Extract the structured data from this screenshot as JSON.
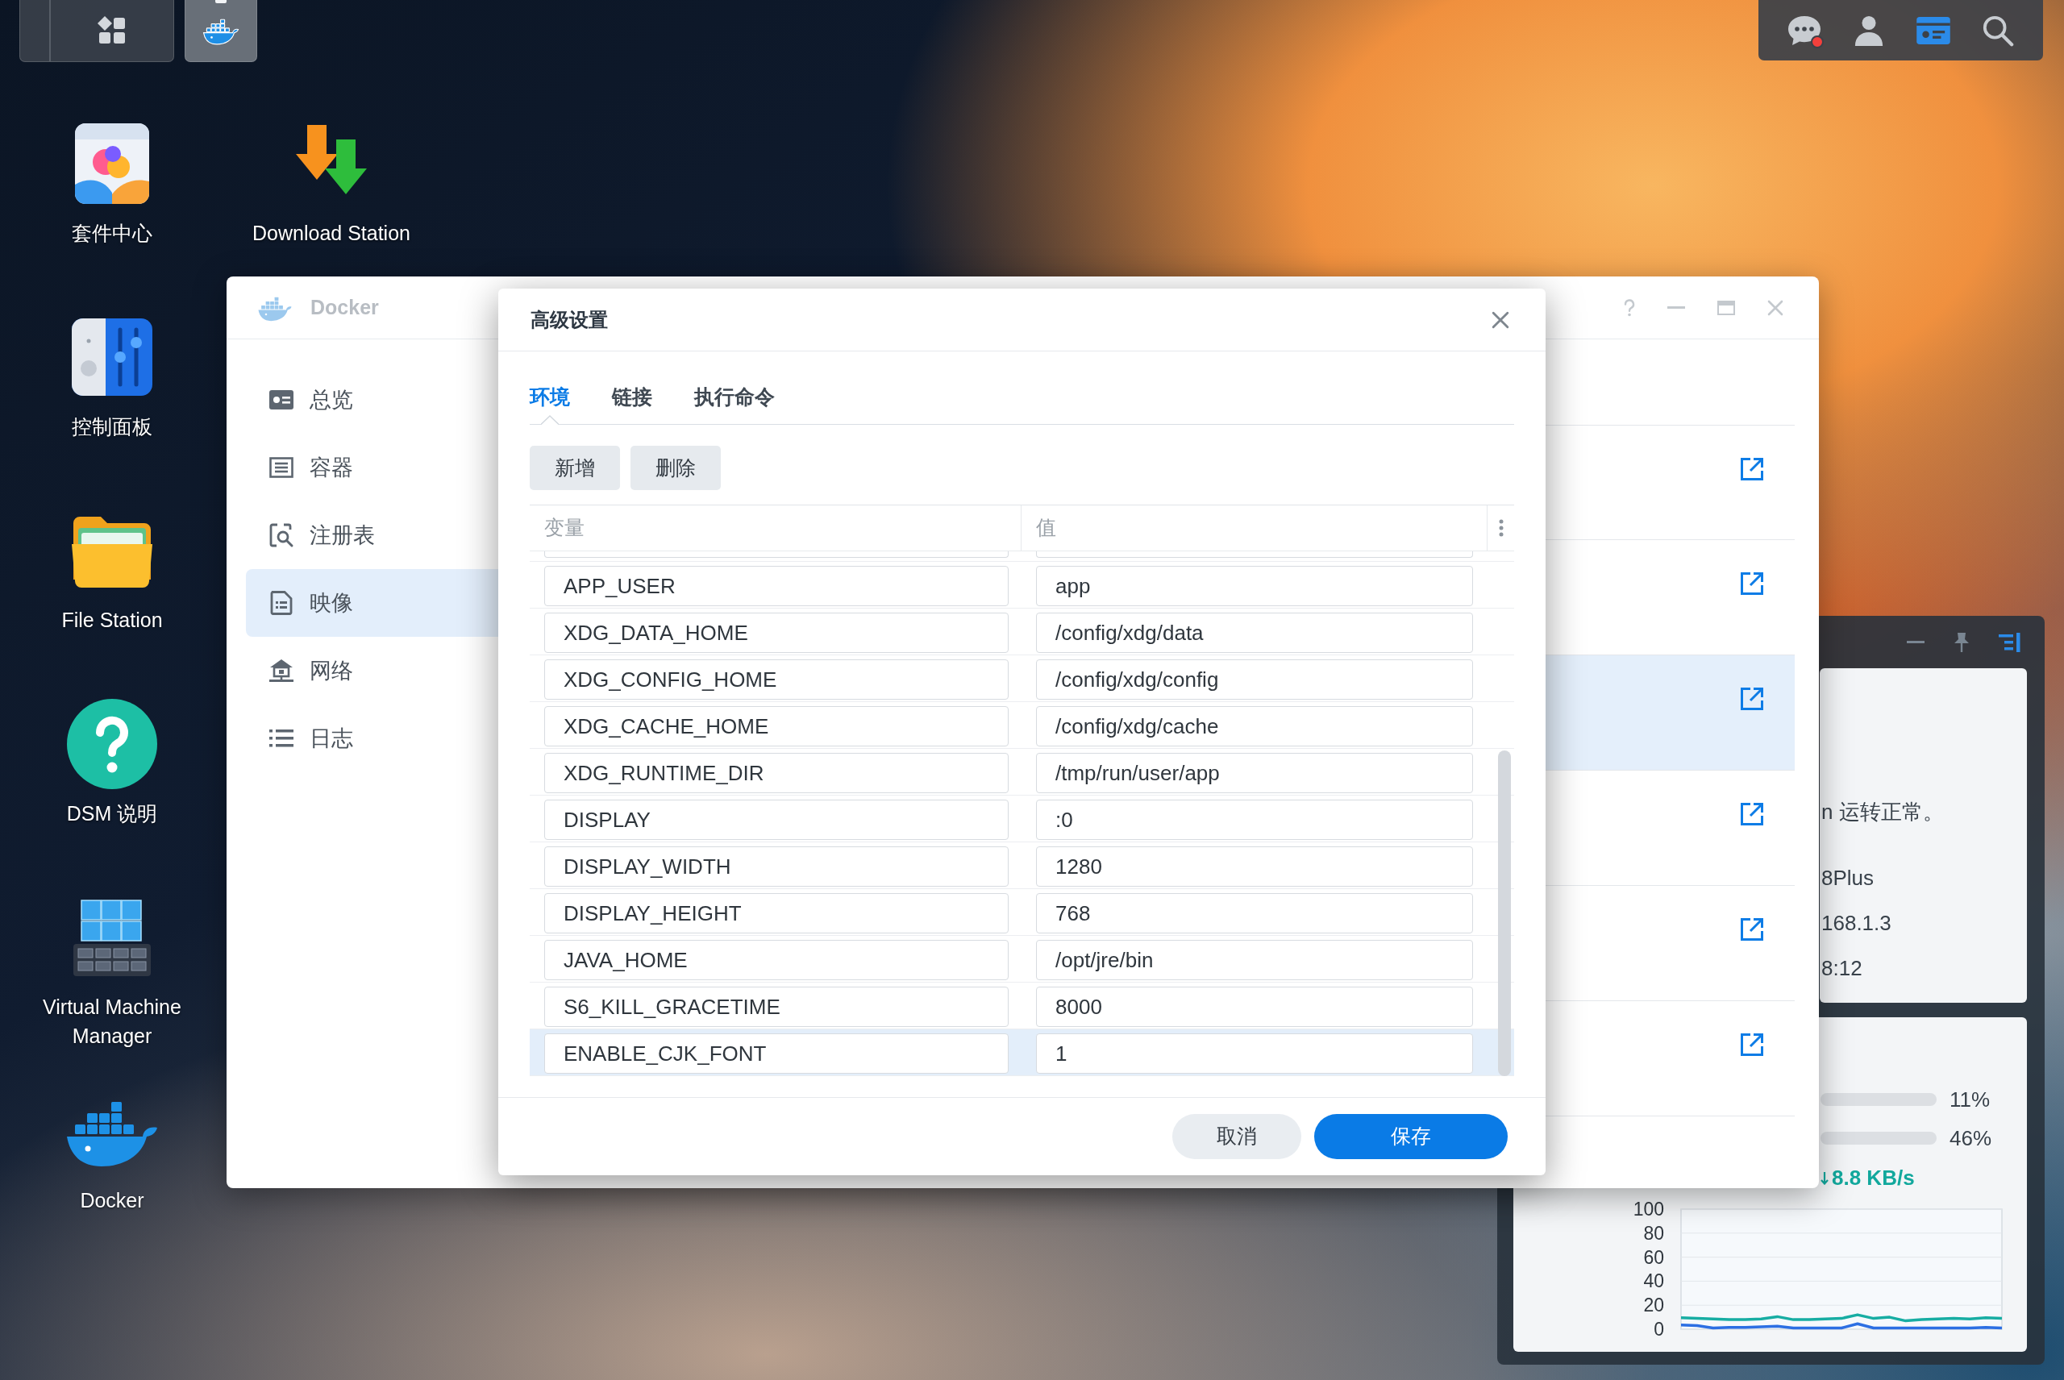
{
  "taskbar": {
    "items": [
      {
        "kind": "main-menu",
        "active": false
      },
      {
        "kind": "docker",
        "active": true
      }
    ]
  },
  "tray": {
    "items": [
      {
        "kind": "notifications",
        "on": false,
        "alert": true
      },
      {
        "kind": "user",
        "on": false,
        "alert": false
      },
      {
        "kind": "widgets",
        "on": true,
        "alert": false
      },
      {
        "kind": "search",
        "on": false,
        "alert": false
      }
    ]
  },
  "desktop_icons": [
    {
      "kind": "package-center",
      "label": "套件中心"
    },
    {
      "kind": "download-station",
      "label": "Download Station"
    },
    {
      "kind": "control-panel",
      "label": "控制面板"
    },
    {
      "kind": "file-station",
      "label": "File Station"
    },
    {
      "kind": "help",
      "label": "DSM 说明"
    },
    {
      "kind": "vmm",
      "label": "Virtual Machine Manager"
    },
    {
      "kind": "docker",
      "label": "Docker"
    }
  ],
  "docker_window": {
    "title": "Docker",
    "active": false,
    "sidebar": {
      "items": [
        {
          "kind": "overview",
          "label": "总览",
          "selected": false
        },
        {
          "kind": "containers",
          "label": "容器",
          "selected": false
        },
        {
          "kind": "registry",
          "label": "注册表",
          "selected": false
        },
        {
          "kind": "images",
          "label": "映像",
          "selected": true
        },
        {
          "kind": "network",
          "label": "网络",
          "selected": false
        },
        {
          "kind": "logs",
          "label": "日志",
          "selected": false
        }
      ]
    },
    "image_list": {
      "rows": [
        {
          "selected": false
        },
        {
          "selected": false
        },
        {
          "selected": true
        },
        {
          "selected": false
        },
        {
          "selected": false
        },
        {
          "selected": false
        }
      ]
    }
  },
  "dialog": {
    "title": "高级设置",
    "tabs": [
      {
        "label": "环境",
        "selected": true
      },
      {
        "label": "链接",
        "selected": false
      },
      {
        "label": "执行命令",
        "selected": false
      }
    ],
    "toolbar": [
      "新增",
      "删除"
    ],
    "table": {
      "columns": [
        "变量",
        "值"
      ],
      "rows": [
        {
          "variable": "APP_USER",
          "value": "app",
          "selected": false
        },
        {
          "variable": "XDG_DATA_HOME",
          "value": "/config/xdg/data",
          "selected": false
        },
        {
          "variable": "XDG_CONFIG_HOME",
          "value": "/config/xdg/config",
          "selected": false
        },
        {
          "variable": "XDG_CACHE_HOME",
          "value": "/config/xdg/cache",
          "selected": false
        },
        {
          "variable": "XDG_RUNTIME_DIR",
          "value": "/tmp/run/user/app",
          "selected": false
        },
        {
          "variable": "DISPLAY",
          "value": ":0",
          "selected": false
        },
        {
          "variable": "DISPLAY_WIDTH",
          "value": "1280",
          "selected": false
        },
        {
          "variable": "DISPLAY_HEIGHT",
          "value": "768",
          "selected": false
        },
        {
          "variable": "JAVA_HOME",
          "value": "/opt/jre/bin",
          "selected": false
        },
        {
          "variable": "S6_KILL_GRACETIME",
          "value": "8000",
          "selected": false
        },
        {
          "variable": "ENABLE_CJK_FONT",
          "value": "1",
          "selected": true
        }
      ]
    },
    "buttons": [
      {
        "kind": "secondary",
        "label": "取消"
      },
      {
        "kind": "primary",
        "label": "保存"
      }
    ]
  },
  "widget_panel": {
    "status_card": {
      "message": "n 运转正常。",
      "details": [
        "8Plus",
        "168.1.3",
        "8:12"
      ]
    },
    "resource_card": {
      "meters": [
        {
          "reading": "11%"
        },
        {
          "reading": "46%"
        }
      ],
      "network": "8.8 KB/s",
      "chart_data": {
        "type": "line",
        "grid": true,
        "ylim": [
          0,
          100
        ],
        "yticks": [
          0,
          20,
          40,
          60,
          80,
          100
        ],
        "series": [
          {
            "color": "#17ada3",
            "values": [
              9.5,
              9,
              8.5,
              8,
              8,
              8.5,
              10.5,
              8,
              8,
              8.5,
              9,
              12,
              9,
              10,
              7,
              8,
              8.5,
              9,
              8.5,
              9.5,
              9
            ]
          },
          {
            "color": "#2c6fe3",
            "values": [
              3.5,
              3,
              1,
              1.5,
              1.5,
              2,
              2.5,
              1,
              1,
              1,
              1,
              4.5,
              1,
              1,
              1,
              1,
              1,
              1,
              1,
              1.5,
              1
            ]
          }
        ]
      }
    }
  }
}
